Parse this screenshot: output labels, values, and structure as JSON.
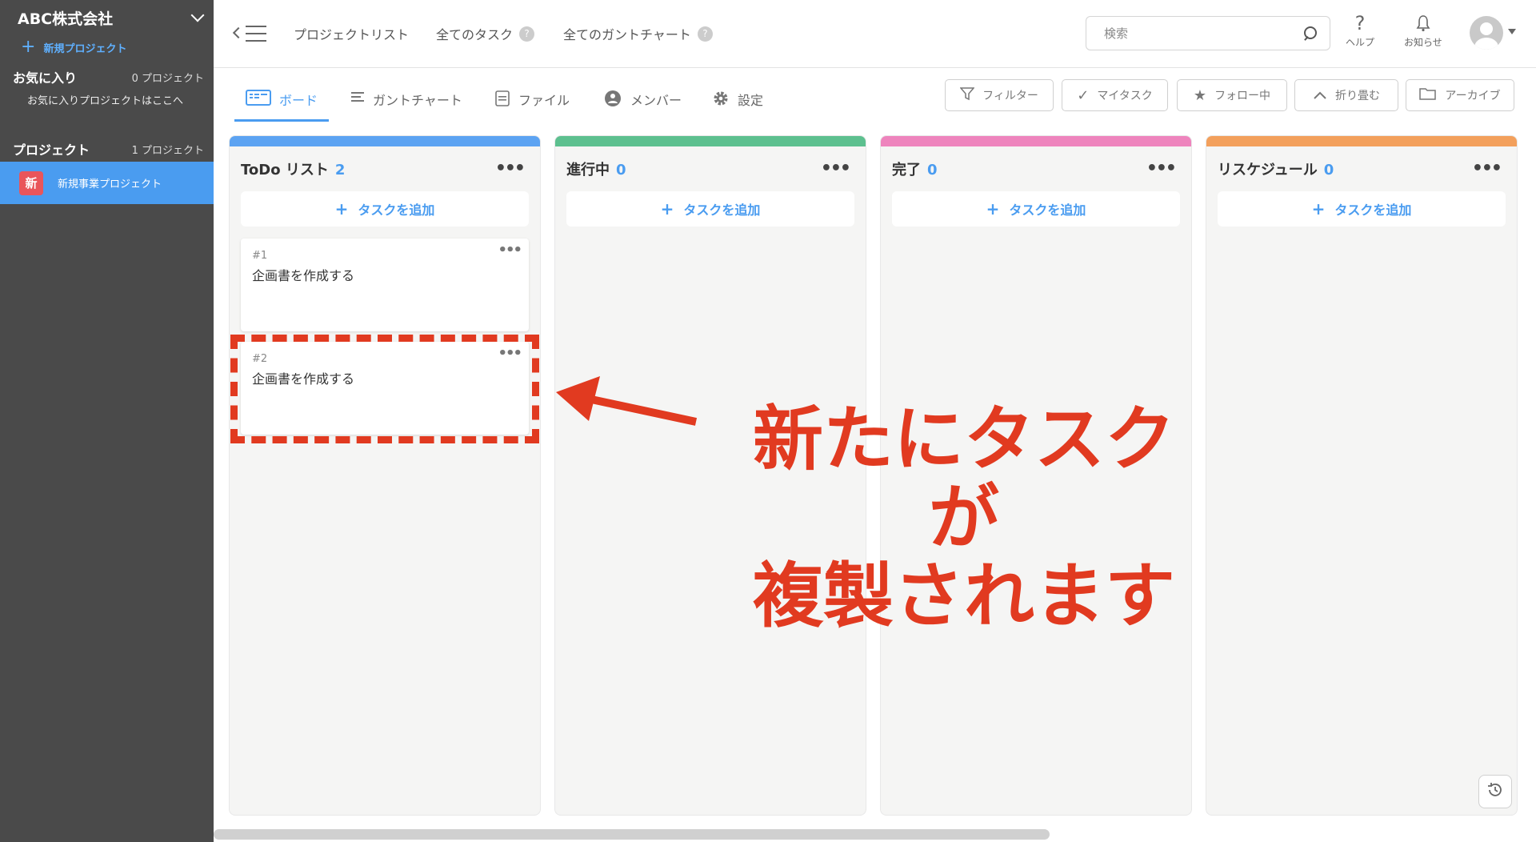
{
  "sidebar": {
    "org_name": "ABC株式会社",
    "new_project": "新規プロジェクト",
    "favorites": {
      "title": "お気に入り",
      "count": "0 プロジェクト",
      "empty": "お気に入りプロジェクトはここへ"
    },
    "projects": {
      "title": "プロジェクト",
      "count": "1 プロジェクト",
      "items": [
        {
          "badge": "新",
          "name": "新規事業プロジェクト"
        }
      ]
    }
  },
  "topbar": {
    "nav": [
      {
        "label": "プロジェクトリスト"
      },
      {
        "label": "全てのタスク"
      },
      {
        "label": "全てのガントチャート"
      }
    ],
    "search_placeholder": "検索",
    "help_label": "ヘルプ",
    "notify_label": "お知らせ"
  },
  "toolbar": {
    "tabs": [
      {
        "label": "ボード"
      },
      {
        "label": "ガントチャート"
      },
      {
        "label": "ファイル"
      },
      {
        "label": "メンバー"
      },
      {
        "label": "設定"
      }
    ],
    "actions": [
      {
        "label": "フィルター"
      },
      {
        "label": "マイタスク"
      },
      {
        "label": "フォロー中"
      },
      {
        "label": "折り畳む"
      },
      {
        "label": "アーカイブ"
      }
    ]
  },
  "board": {
    "add_task_label": "タスクを追加",
    "columns": [
      {
        "title": "ToDo リスト",
        "count": "2",
        "color": "#5ca3f2",
        "cards": [
          {
            "num": "#1",
            "title": "企画書を作成する"
          },
          {
            "num": "#2",
            "title": "企画書を作成する"
          }
        ]
      },
      {
        "title": "進行中",
        "count": "0",
        "color": "#5dc08f",
        "cards": []
      },
      {
        "title": "完了",
        "count": "0",
        "color": "#ee84bd",
        "cards": []
      },
      {
        "title": "リスケジュール",
        "count": "0",
        "color": "#f3a05c",
        "cards": []
      }
    ]
  },
  "annotation": {
    "line1": "新たにタスクが",
    "line2": "複製されます",
    "color": "#e13a20"
  }
}
